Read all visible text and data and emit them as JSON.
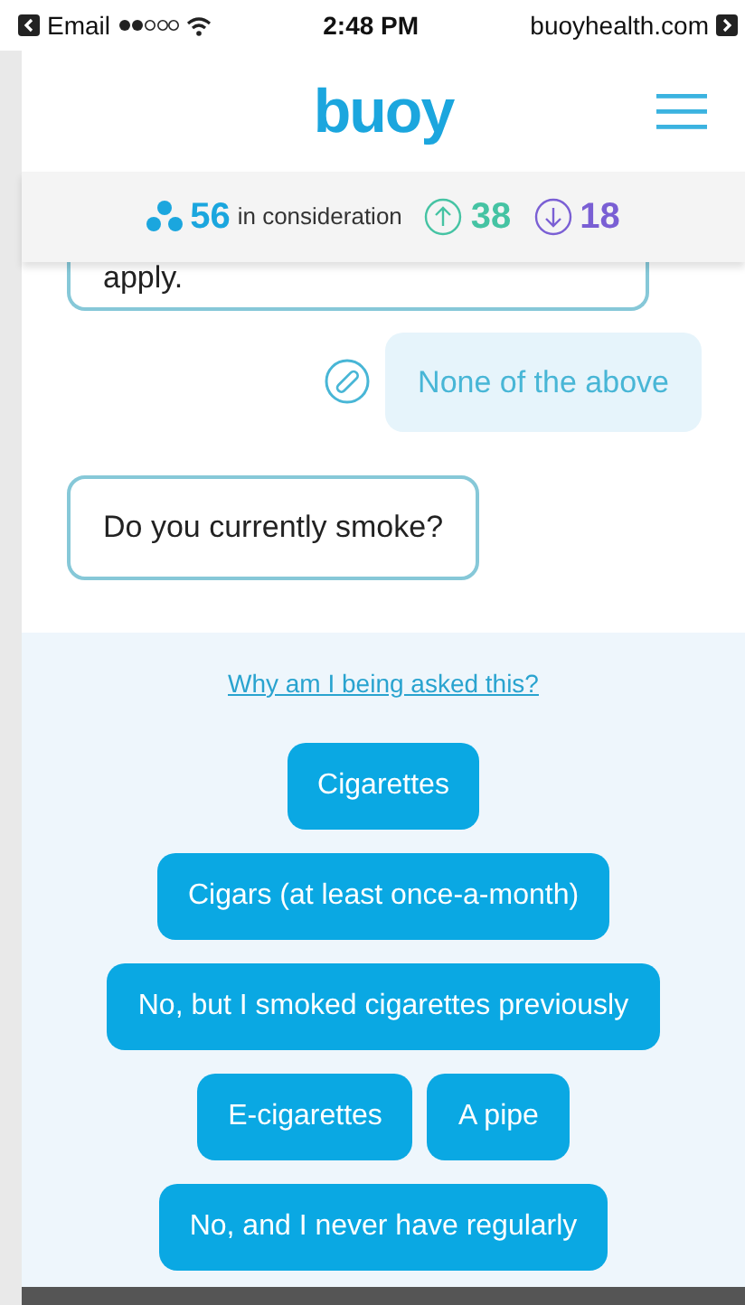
{
  "status_bar": {
    "back_label": "Email",
    "time": "2:48 PM",
    "site": "buoyhealth.com"
  },
  "header": {
    "logo": "buoy"
  },
  "counter": {
    "total": "56",
    "label": "in consideration",
    "up": "38",
    "down": "18"
  },
  "chat": [
    {
      "kind": "question",
      "text": "apply."
    },
    {
      "kind": "answer",
      "text": "None of the above"
    },
    {
      "kind": "question",
      "text": "Do you currently smoke?"
    }
  ],
  "why_link": "Why am I being asked this?",
  "option_rows": [
    {
      "options": [
        {
          "label": "Cigarettes"
        }
      ]
    },
    {
      "options": [
        {
          "label": "Cigars (at least once-a-month)"
        }
      ]
    },
    {
      "options": [
        {
          "label": "No, but I smoked cigarettes previously"
        }
      ]
    },
    {
      "options": [
        {
          "label": "E-cigarettes"
        },
        {
          "label": "A pipe"
        }
      ]
    },
    {
      "options": [
        {
          "label": "No, and I never have regularly"
        }
      ]
    }
  ]
}
